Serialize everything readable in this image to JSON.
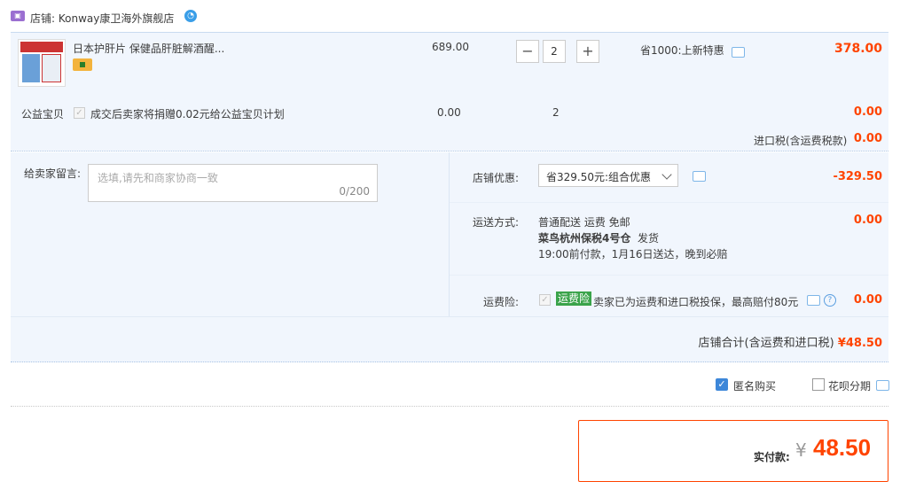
{
  "shop": {
    "label": "店铺: Konway康卫海外旗舰店",
    "badge_icon": "tmall-global-icon",
    "chat_icon": "wangwang-chat-icon"
  },
  "product": {
    "title": "日本护肝片 保健品肝脏解酒醒...",
    "unit_price": "689.00",
    "quantity": "2",
    "minus": "−",
    "plus": "+",
    "discount": "省1000:上新特惠",
    "total": "378.00"
  },
  "charity": {
    "label": "公益宝贝",
    "text": "成交后卖家将捐赠0.02元给公益宝贝计划",
    "price": "0.00",
    "qty": "2",
    "total": "0.00"
  },
  "import_tax": {
    "label": "进口税(含运费税款)",
    "value": "0.00"
  },
  "message": {
    "label": "给卖家留言:",
    "placeholder": "选填,请先和商家协商一致",
    "count": "0/200"
  },
  "promo": {
    "label": "店铺优惠:",
    "selected": "省329.50元:组合优惠",
    "value": "-329.50"
  },
  "shipping": {
    "label": "运送方式:",
    "line1": "普通配送 运费 免邮",
    "line2_bold": "菜鸟杭州保税4号仓",
    "line2_rest": "发货",
    "line3": "19:00前付款，1月16日送达，晚到必赔",
    "value": "0.00"
  },
  "insurance": {
    "label": "运费险:",
    "tag": "运费险",
    "text": "卖家已为运费和进口税投保，最高赔付80元",
    "value": "0.00"
  },
  "shop_total": {
    "label": "店铺合计(含运费和进口税)",
    "value": "¥48.50"
  },
  "options": {
    "anonymous": "匿名购买",
    "anonymous_checked": true,
    "huabei": "花呗分期",
    "huabei_checked": false
  },
  "pay": {
    "label": "实付款:",
    "currency": "¥",
    "amount": "48.50"
  },
  "colors": {
    "accent": "#ff4400",
    "panel_bg": "#f1f6fd",
    "checkbox_blue": "#3d87d9",
    "tag_green": "#3aa34a"
  }
}
